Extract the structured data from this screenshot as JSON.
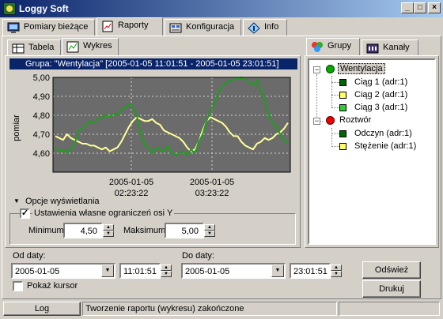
{
  "window": {
    "title": "Loggy Soft"
  },
  "colors": {
    "green_line": "#1e9e1e",
    "yellow_line": "#ffff99",
    "title_bar": "#0a246a",
    "group_header": "#0a246a"
  },
  "main_tabs": [
    {
      "label": "Pomiary bieżące",
      "icon": "monitor-icon"
    },
    {
      "label": "Raporty",
      "icon": "report-icon"
    },
    {
      "label": "Konfiguracja",
      "icon": "config-icon"
    },
    {
      "label": "Info",
      "icon": "info-icon"
    }
  ],
  "sub_tabs": [
    {
      "label": "Tabela"
    },
    {
      "label": "Wykres"
    }
  ],
  "right_tabs": [
    {
      "label": "Grupy"
    },
    {
      "label": "Kanały"
    }
  ],
  "chart_header": "Grupa: \"Wentylacja\" [2005-01-05 11:01:51  -  2005-01-05 23:01:51]",
  "chart_data": {
    "type": "line",
    "ylabel": "pomiar",
    "ylim": [
      4.5,
      5.0
    ],
    "yticks": [
      "5,00",
      "4,90",
      "4,80",
      "4,70",
      "4,60"
    ],
    "xticks": [
      {
        "line1": "2005-01-05",
        "line2": "02:23:22"
      },
      {
        "line1": "2005-01-05",
        "line2": "03:23:22"
      }
    ],
    "grid": true,
    "series": [
      {
        "color": "#1e9e1e",
        "values": [
          4.63,
          4.61,
          4.62,
          4.6,
          4.62,
          4.65,
          4.72,
          4.73,
          4.75,
          4.77,
          4.76,
          4.78,
          4.79,
          4.8,
          4.79,
          4.81,
          4.8,
          4.83,
          4.84,
          4.86,
          4.84,
          4.8,
          4.7,
          4.65,
          4.63,
          4.6,
          4.63,
          4.62,
          4.61,
          4.64,
          4.6,
          4.59,
          4.6,
          4.61,
          4.59,
          4.62,
          4.6,
          4.66,
          4.7,
          4.77,
          4.82,
          4.86,
          4.92,
          4.95,
          4.97,
          4.98,
          4.99,
          4.99,
          5.0,
          4.99,
          4.97,
          4.96,
          4.99,
          4.93,
          4.88,
          4.8,
          4.76,
          4.74,
          4.7,
          4.67,
          4.65
        ]
      },
      {
        "color": "#ffff99",
        "values": [
          4.69,
          4.68,
          4.67,
          4.7,
          4.68,
          4.67,
          4.66,
          4.65,
          4.65,
          4.64,
          4.64,
          4.63,
          4.62,
          4.63,
          4.61,
          4.62,
          4.63,
          4.66,
          4.7,
          4.74,
          4.77,
          4.79,
          4.78,
          4.77,
          4.77,
          4.78,
          4.76,
          4.75,
          4.72,
          4.71,
          4.7,
          4.69,
          4.68,
          4.66,
          4.63,
          4.61,
          4.62,
          4.66,
          4.72,
          4.77,
          4.79,
          4.78,
          4.77,
          4.76,
          4.74,
          4.71,
          4.69,
          4.69,
          4.66,
          4.64,
          4.63,
          4.62,
          4.65,
          4.66,
          4.68,
          4.67,
          4.68,
          4.7,
          4.71,
          4.73,
          4.76
        ]
      }
    ]
  },
  "display_options": {
    "toggle_label": "Opcje wyświetlania",
    "custom_limits_label": "Ustawienia własne ograniczeń osi Y",
    "custom_limits_checked": true,
    "min_label": "Minimum",
    "min_value": "4,50",
    "max_label": "Maksimum",
    "max_value": "5,00"
  },
  "tree": {
    "groups": [
      {
        "label": "Wentylacja",
        "color": "#00aa00",
        "selected": true,
        "channels": [
          {
            "label": "Ciąg 1 (adr:1)",
            "color": "#006600"
          },
          {
            "label": "Ciąg 2 (adr:1)",
            "color": "#ffff66"
          },
          {
            "label": "Ciąg 3 (adr:1)",
            "color": "#33cc33"
          }
        ]
      },
      {
        "label": "Roztwór",
        "color": "#ee0000",
        "selected": false,
        "channels": [
          {
            "label": "Odczyn (adr:1)",
            "color": "#006600"
          },
          {
            "label": "Stężenie (adr:1)",
            "color": "#ffff66"
          }
        ]
      }
    ]
  },
  "range": {
    "from_label": "Od daty:",
    "from_date": "2005-01-05",
    "from_time": "11:01:51",
    "to_label": "Do daty:",
    "to_date": "2005-01-05",
    "to_time": "23:01:51",
    "show_cursor_label": "Pokaż kursor",
    "show_cursor_checked": false
  },
  "buttons": {
    "refresh": "Odśwież",
    "print": "Drukuj"
  },
  "status": {
    "log_label": "Log",
    "message": "Tworzenie raportu (wykresu) zakończone"
  }
}
